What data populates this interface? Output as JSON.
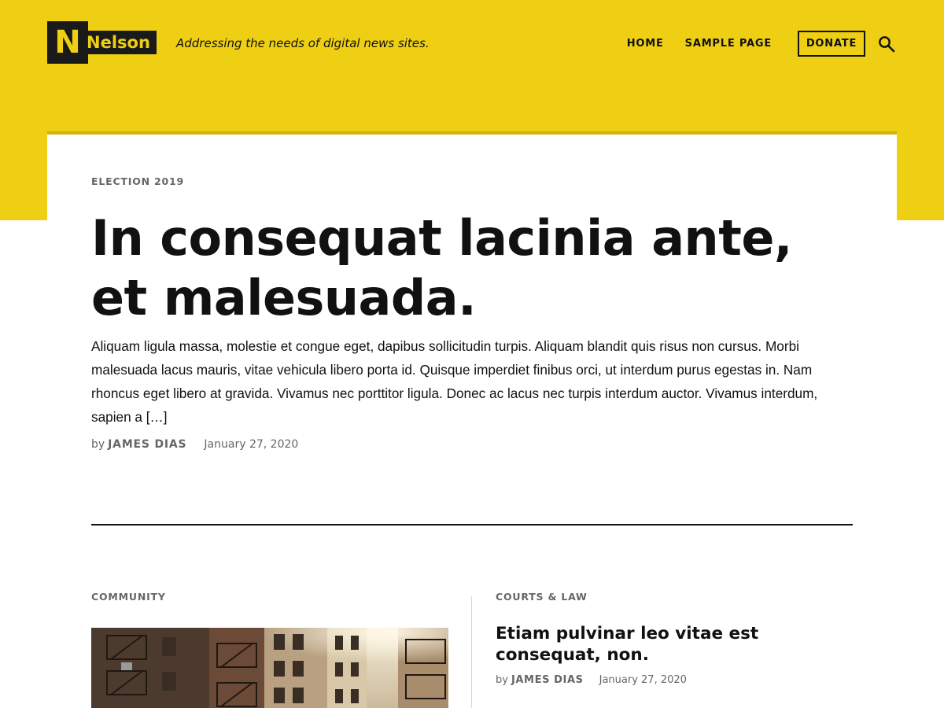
{
  "header": {
    "logo_letter": "N",
    "logo_word": "Nelson",
    "tagline": "Addressing the needs of digital news sites.",
    "nav": [
      {
        "label": "HOME"
      },
      {
        "label": "SAMPLE PAGE"
      }
    ],
    "donate_label": "DONATE",
    "search_icon": "search-icon"
  },
  "colors": {
    "accent": "#eecf14",
    "accent_dark": "#d2b40e",
    "text": "#111111",
    "muted": "#666666"
  },
  "featured": {
    "category": "ELECTION 2019",
    "title": "In consequat lacinia ante, et malesuada.",
    "excerpt": "Aliquam ligula massa, molestie et congue eget, dapibus sollicitudin turpis. Aliquam blandit quis risus non cursus. Morbi malesuada lacus mauris, vitae vehicula libero porta id. Quisque imperdiet finibus orci, ut interdum purus egestas in. Nam rhoncus eget libero at gravida. Vivamus nec porttitor ligula. Donec ac lacus nec turpis interdum auctor. Vivamus interdum, sapien a […]",
    "by": "by",
    "author": "JAMES DIAS",
    "date": "January 27, 2020"
  },
  "posts": [
    {
      "category": "COMMUNITY",
      "image": "city-alley-photo"
    },
    {
      "category": "COURTS & LAW",
      "title": "Etiam pulvinar leo vitae est consequat, non.",
      "by": "by",
      "author": "JAMES DIAS",
      "date": "January 27, 2020"
    }
  ]
}
